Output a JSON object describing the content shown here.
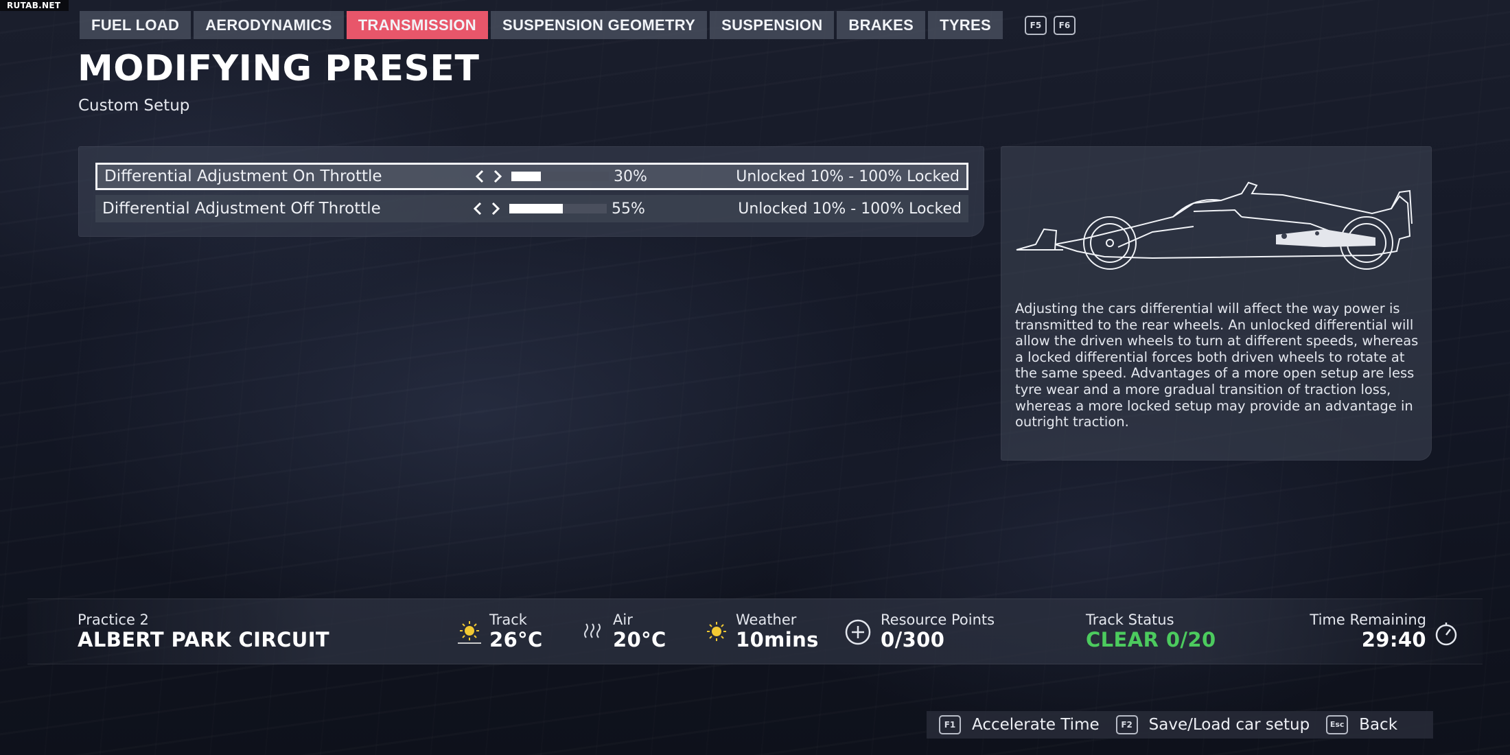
{
  "watermark": "RUTAB.NET",
  "tabs": [
    {
      "label": "FUEL LOAD"
    },
    {
      "label": "AERODYNAMICS"
    },
    {
      "label": "TRANSMISSION"
    },
    {
      "label": "SUSPENSION GEOMETRY"
    },
    {
      "label": "SUSPENSION"
    },
    {
      "label": "BRAKES"
    },
    {
      "label": "TYRES"
    }
  ],
  "tab_keys": {
    "prev": "F5",
    "next": "F6"
  },
  "header": {
    "title": "MODIFYING PRESET",
    "subtitle": "Custom Setup"
  },
  "settings": [
    {
      "label": "Differential Adjustment On Throttle",
      "value_text": "30%",
      "value_fraction": 0.3,
      "range": "Unlocked 10% - 100% Locked",
      "selected": true
    },
    {
      "label": "Differential Adjustment Off Throttle",
      "value_text": "55%",
      "value_fraction": 0.55,
      "range": "Unlocked 10% - 100% Locked",
      "selected": false
    }
  ],
  "info": {
    "text": "Adjusting the cars differential will affect the way power is transmitted to the rear wheels. An unlocked differential will allow the driven wheels to turn at different speeds, whereas a locked differential forces both driven wheels to rotate at the same speed. Advantages of a more open setup are less tyre wear and a more gradual transition of traction loss, whereas a more locked setup may provide an advantage in outright traction."
  },
  "status": {
    "session": "Practice 2",
    "circuit": "ALBERT PARK CIRCUIT",
    "track_label": "Track",
    "track_value": "26°C",
    "air_label": "Air",
    "air_value": "20°C",
    "weather_label": "Weather",
    "weather_value": "10mins",
    "resource_label": "Resource Points",
    "resource_value": "0/300",
    "track_status_label": "Track Status",
    "track_status_value": "CLEAR 0/20",
    "time_label": "Time Remaining",
    "time_value": "29:40"
  },
  "footer": [
    {
      "key": "F1",
      "label": "Accelerate Time"
    },
    {
      "key": "F2",
      "label": "Save/Load car setup"
    },
    {
      "key": "Esc",
      "label": "Back"
    }
  ],
  "colors": {
    "accent": "#e8566a",
    "status_green": "#4ccb5e"
  }
}
